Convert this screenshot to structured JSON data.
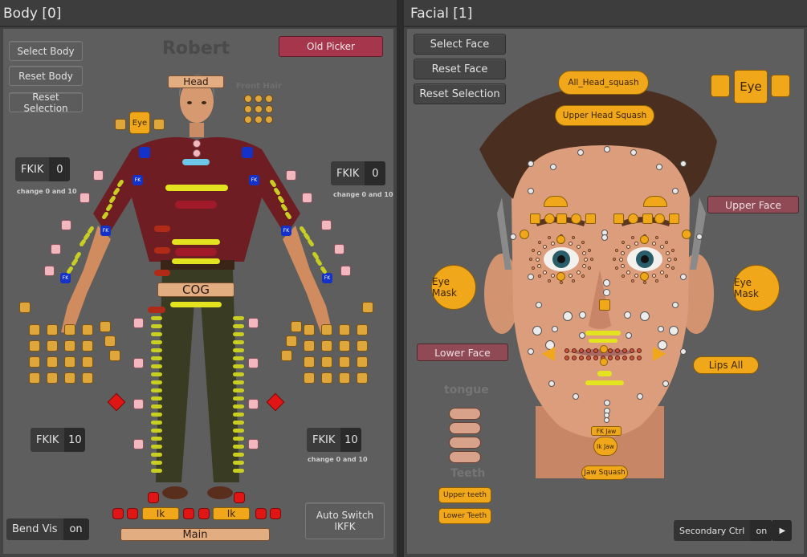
{
  "body_panel": {
    "title": "Body [0]",
    "character_name": "Robert",
    "select_body": "Select Body",
    "reset_body": "Reset Body",
    "reset_selection": "Reset Selection",
    "old_picker": "Old Picker",
    "head": "Head",
    "front_hair": "Front Hair",
    "eye": "Eye",
    "cog": "COG",
    "main": "Main",
    "ik": "Ik",
    "fk": "FK",
    "fkik_label": "FKIK",
    "fkik_upper_left": "0",
    "fkik_upper_right": "0",
    "fkik_lower_left": "10",
    "fkik_lower_right": "10",
    "change_note": "change 0 and 10",
    "bend_vis_label": "Bend Vis",
    "bend_vis_value": "on",
    "auto_switch": "Auto Switch IKFK"
  },
  "facial_panel": {
    "title": "Facial [1]",
    "select_face": "Select Face",
    "reset_face": "Reset Face",
    "reset_selection": "Reset Selection",
    "all_head_squash": "All_Head_squash",
    "upper_head_squash": "Upper Head Squash",
    "eye": "Eye",
    "upper_face": "Upper Face",
    "eye_mask": "Eye Mask",
    "lower_face": "Lower Face",
    "lips_all": "Lips All",
    "tongue": "tongue",
    "teeth": "Teeth",
    "upper_teeth": "Upper teeth",
    "lower_teeth": "Lower Teeth",
    "fk_jaw": "FK Jaw",
    "ik_jaw": "Ik Jaw",
    "jaw_squash": "Jaw Squash",
    "secondary_ctrl_label": "Secondary Ctrl",
    "secondary_ctrl_value": "on"
  },
  "colors": {
    "control_orange": "#f0a81a",
    "control_red": "#e01616",
    "fk_blue": "#1431c9",
    "key_yellow": "#c9cf22",
    "pink": "#f3b8be",
    "old_picker_red": "#a5364c"
  }
}
